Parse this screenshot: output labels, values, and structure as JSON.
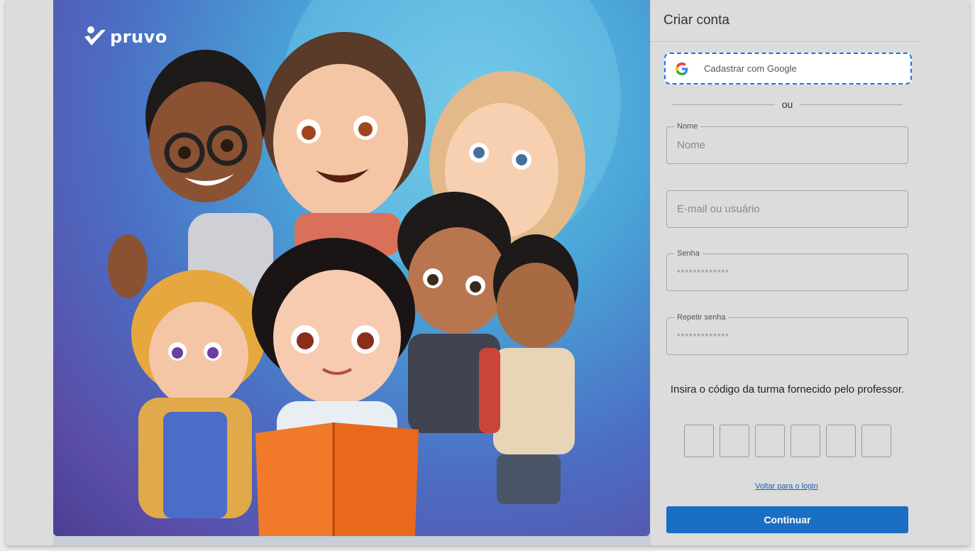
{
  "brand": {
    "name": "pruvo"
  },
  "form": {
    "title": "Criar conta",
    "google_button": "Cadastrar com Google",
    "divider": "ou",
    "fields": {
      "name": {
        "legend": "Nome",
        "placeholder": "Nome"
      },
      "email": {
        "placeholder": "E-mail ou usuário"
      },
      "password": {
        "legend": "Senha",
        "placeholder": "*************"
      },
      "repeat_password": {
        "legend": "Repetir senha",
        "placeholder": "*************"
      }
    },
    "class_code": {
      "label": "Insira o código da turma fornecido pelo professor.",
      "digits": 6
    },
    "back_link": "Voltar para o login",
    "continue_button": "Continuar"
  },
  "colors": {
    "accent": "#1a6fc4",
    "focus_outline": "#1a73e8",
    "panel": "#dcdcdc"
  }
}
